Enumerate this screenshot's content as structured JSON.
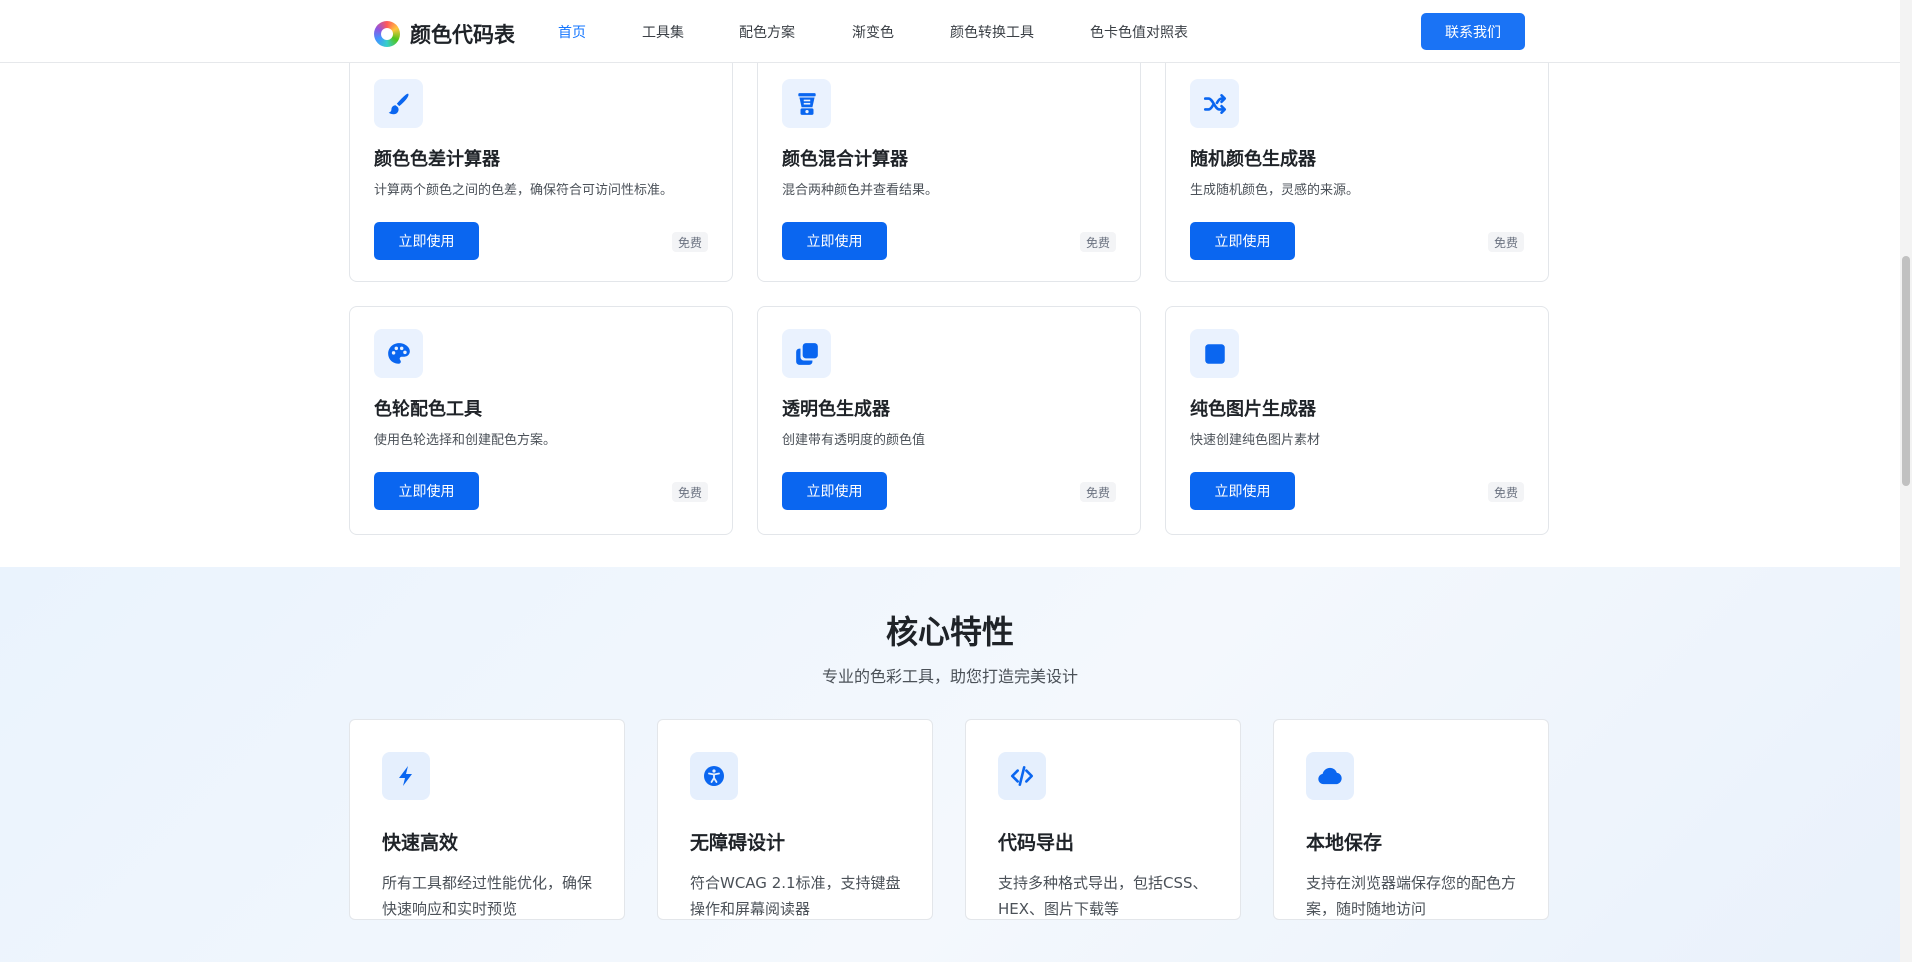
{
  "colors": {
    "accent": "#1677ff",
    "button": "#0a66f0",
    "icon": "#0a66f0"
  },
  "header": {
    "logo_text": "颜色代码表",
    "nav": [
      "首页",
      "工具集",
      "配色方案",
      "渐变色",
      "颜色转换工具",
      "色卡色值对照表"
    ],
    "active_nav": "首页",
    "contact": "联系我们"
  },
  "tools": [
    {
      "icon": "paintbrush-icon",
      "title": "颜色色差计算器",
      "desc": "计算两个颜色之间的色差，确保符合可访问性标准。",
      "button": "立即使用",
      "badge": "免费"
    },
    {
      "icon": "blender-icon",
      "title": "颜色混合计算器",
      "desc": "混合两种颜色并查看结果。",
      "button": "立即使用",
      "badge": "免费"
    },
    {
      "icon": "shuffle-icon",
      "title": "随机颜色生成器",
      "desc": "生成随机颜色，灵感的来源。",
      "button": "立即使用",
      "badge": "免费"
    },
    {
      "icon": "palette-icon",
      "title": "色轮配色工具",
      "desc": "使用色轮选择和创建配色方案。",
      "button": "立即使用",
      "badge": "免费"
    },
    {
      "icon": "layers-icon",
      "title": "透明色生成器",
      "desc": "创建带有透明度的颜色值",
      "button": "立即使用",
      "badge": "免费"
    },
    {
      "icon": "square-icon",
      "title": "纯色图片生成器",
      "desc": "快速创建纯色图片素材",
      "button": "立即使用",
      "badge": "免费"
    }
  ],
  "features": {
    "title": "核心特性",
    "subtitle": "专业的色彩工具，助您打造完美设计",
    "items": [
      {
        "icon": "bolt-icon",
        "title": "快速高效",
        "desc": "所有工具都经过性能优化，确保快速响应和实时预览"
      },
      {
        "icon": "accessibility-icon",
        "title": "无障碍设计",
        "desc": "符合WCAG 2.1标准，支持键盘操作和屏幕阅读器"
      },
      {
        "icon": "code-icon",
        "title": "代码导出",
        "desc": "支持多种格式导出，包括CSS、HEX、图片下载等"
      },
      {
        "icon": "cloud-icon",
        "title": "本地保存",
        "desc": "支持在浏览器端保存您的配色方案，随时随地访问"
      }
    ]
  }
}
